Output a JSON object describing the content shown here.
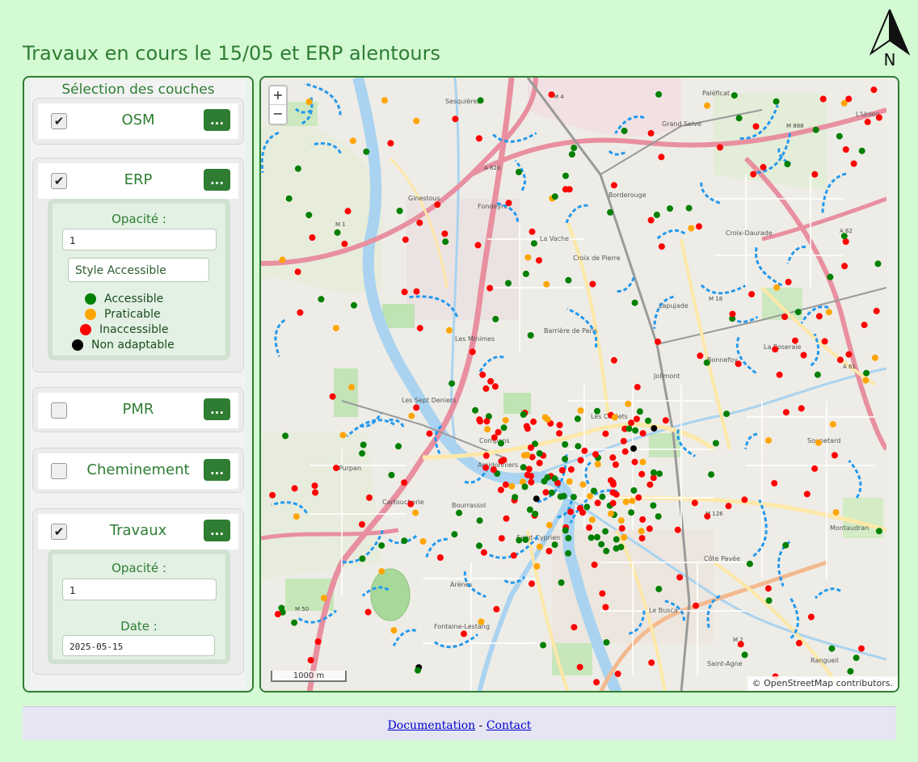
{
  "page": {
    "title": "Travaux en cours le 15/05 et ERP alentours",
    "north_label": "N"
  },
  "panel": {
    "heading": "Sélection des couches",
    "layers": [
      {
        "name": "OSM",
        "checked": true,
        "button_label": "..."
      },
      {
        "name": "ERP",
        "checked": true,
        "button_label": "...",
        "options": {
          "opacity_label": "Opacité :",
          "opacity_value": "1",
          "style_value": "Style Accessible",
          "legend": [
            {
              "label": "Accessible",
              "color": "#008000"
            },
            {
              "label": "Praticable",
              "color": "#ffa500"
            },
            {
              "label": "Inaccessible",
              "color": "#ff0000"
            },
            {
              "label": "Non adaptable",
              "color": "#000000"
            }
          ]
        }
      },
      {
        "name": "PMR",
        "checked": false,
        "button_label": "..."
      },
      {
        "name": "Cheminement",
        "checked": false,
        "button_label": "..."
      },
      {
        "name": "Travaux",
        "checked": true,
        "button_label": "...",
        "options": {
          "opacity_label": "Opacité :",
          "opacity_value": "1",
          "date_label": "Date :",
          "date_value": "2025-05-15"
        }
      }
    ]
  },
  "map": {
    "zoom_in": "+",
    "zoom_out": "−",
    "scale_label": "1000 m",
    "attribution": "© OpenStreetMap contributors.",
    "place_labels": [
      "Sesquières",
      "Grand Selve",
      "Ginestous",
      "Fondeyre",
      "La Vache",
      "Borderouge",
      "Croix-Daurade",
      "Lapujade",
      "Bonnefoy",
      "La Roseraie",
      "Les Sept Deniers",
      "Les Chalets",
      "Purpan",
      "Cartoucherie",
      "Bourrassol",
      "Saint-Cyprien",
      "Arènes",
      "Le Busca",
      "Côte Pavée",
      "Saint-Agne",
      "Rangueil",
      "Croix de Pierre",
      "Barrière de Paris",
      "Amidonniers",
      "Jolimont",
      "Soupetard",
      "Montaudran",
      "Compans",
      "Fontaine-Lestang",
      "Les Minimes",
      "Paléficat",
      "L'Union"
    ],
    "road_labels": [
      "M 1",
      "M 4",
      "A 620",
      "A 62",
      "A 61",
      "M 2",
      "M 50",
      "M 126",
      "M 888",
      "M 18"
    ],
    "legend_colors": {
      "accessible": "#008000",
      "praticable": "#ffa500",
      "inaccessible": "#ff0000",
      "non_adaptable": "#000000",
      "travaux": "#2299ee"
    }
  },
  "footer": {
    "doc_link": "Documentation",
    "separator": " - ",
    "contact_link": "Contact"
  }
}
